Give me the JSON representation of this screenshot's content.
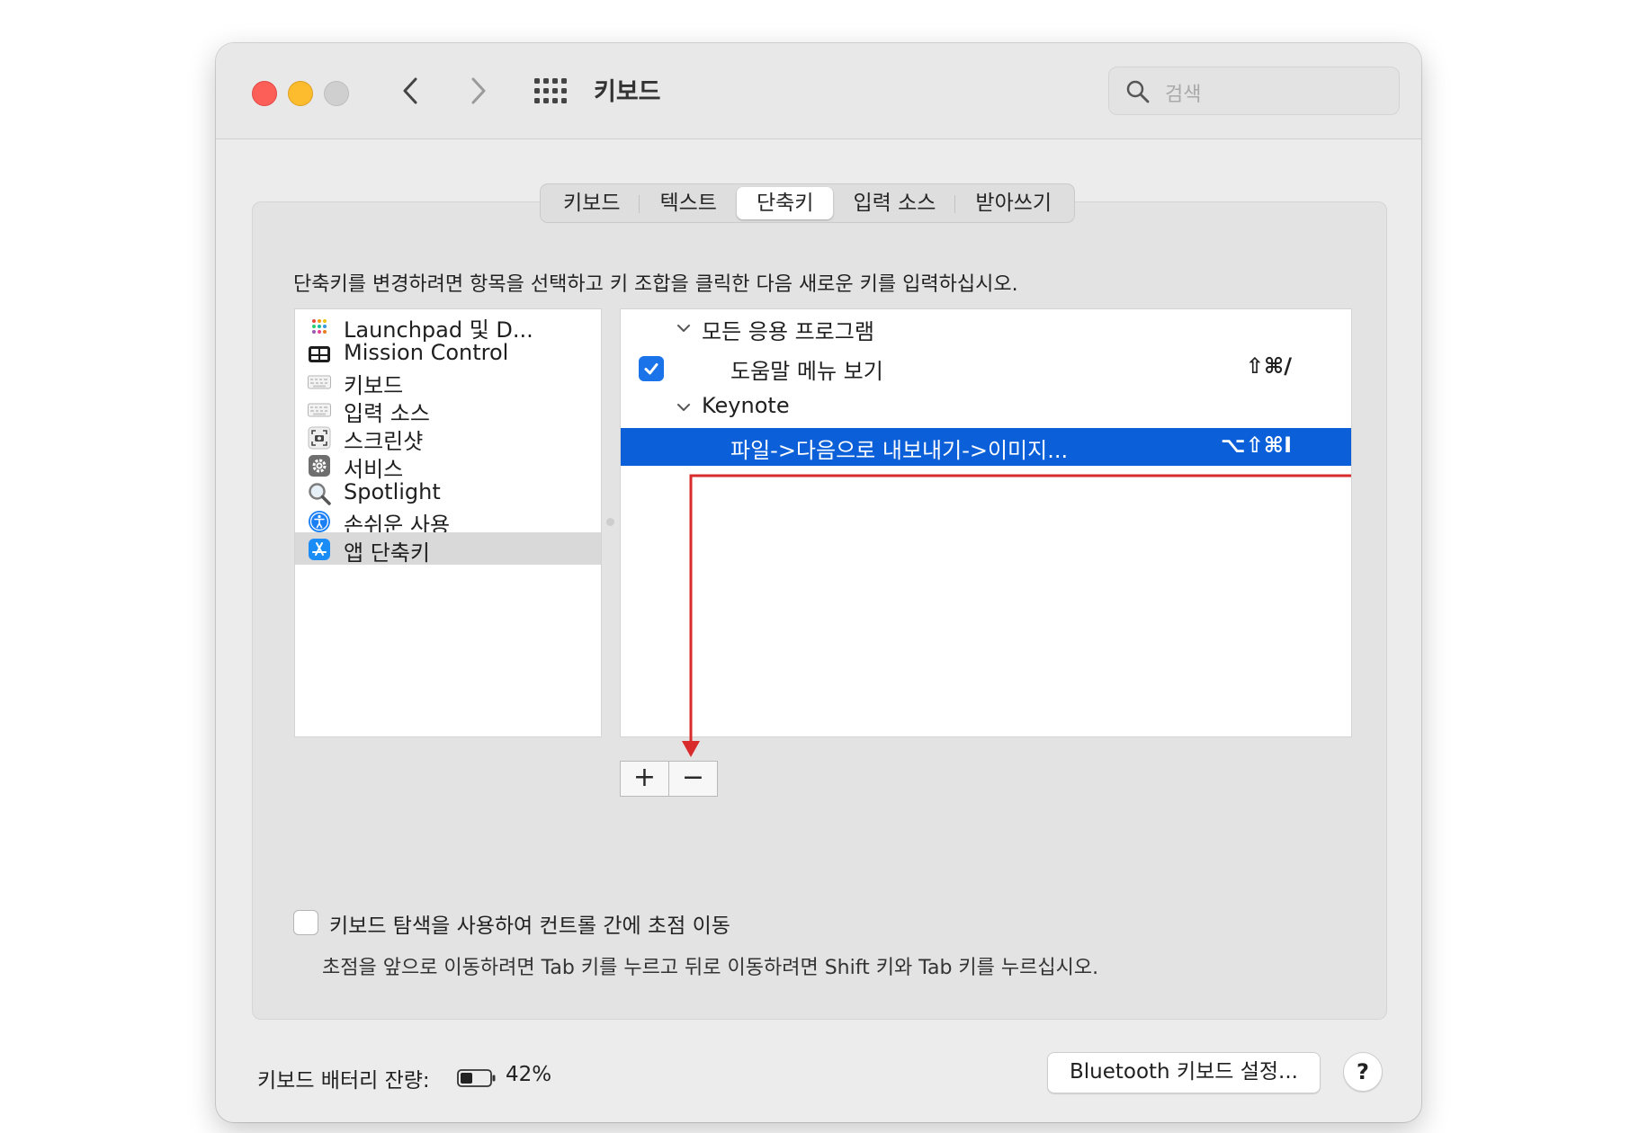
{
  "window": {
    "title": "키보드",
    "search_placeholder": "검색"
  },
  "tabs": [
    {
      "label": "키보드",
      "active": false
    },
    {
      "label": "텍스트",
      "active": false
    },
    {
      "label": "단축키",
      "active": true
    },
    {
      "label": "입력 소스",
      "active": false
    },
    {
      "label": "받아쓰기",
      "active": false
    }
  ],
  "instruction": "단축키를 변경하려면 항목을 선택하고 키 조합을 클릭한 다음 새로운 키를 입력하십시오.",
  "categories": [
    {
      "label": "Launchpad 및 D...",
      "icon": "launchpad-icon",
      "selected": false
    },
    {
      "label": "Mission Control",
      "icon": "mission-control-icon",
      "selected": false
    },
    {
      "label": "키보드",
      "icon": "keyboard-icon",
      "selected": false
    },
    {
      "label": "입력 소스",
      "icon": "input-sources-icon",
      "selected": false
    },
    {
      "label": "스크린샷",
      "icon": "screenshot-icon",
      "selected": false
    },
    {
      "label": "서비스",
      "icon": "services-gear-icon",
      "selected": false
    },
    {
      "label": "Spotlight",
      "icon": "spotlight-icon",
      "selected": false
    },
    {
      "label": "손쉬운 사용",
      "icon": "accessibility-icon",
      "selected": false
    },
    {
      "label": "앱 단축키",
      "icon": "app-store-icon",
      "selected": true
    }
  ],
  "shortcuts": {
    "group_all": "모든 응용 프로그램",
    "help_menu": {
      "name": "도움말 메뉴 보기",
      "keys": "⇧⌘/",
      "checked": true
    },
    "group_keynote": "Keynote",
    "keynote_export": {
      "name": "파일->다음으로 내보내기->이미지...",
      "keys": "⌥⇧⌘I",
      "selected": true
    }
  },
  "buttons": {
    "add": "+",
    "remove": "−",
    "bluetooth": "Bluetooth 키보드 설정...",
    "help": "?"
  },
  "keyboard_navigation": {
    "checked": false,
    "label": "키보드 탐색을 사용하여 컨트롤 간에 초점 이동",
    "hint": "초점을 앞으로 이동하려면 Tab 키를 누르고 뒤로 이동하려면 Shift 키와 Tab 키를 누르십시오."
  },
  "battery": {
    "label": "키보드 배터리 잔량:",
    "percent_text": "42%",
    "level": 0.42
  },
  "colors": {
    "selection": "#0b5fd8",
    "checkbox": "#1a73e8",
    "annotation_arrow": "#d92b2b",
    "close": "#fc5f57",
    "minimize": "#fdbc2e"
  }
}
